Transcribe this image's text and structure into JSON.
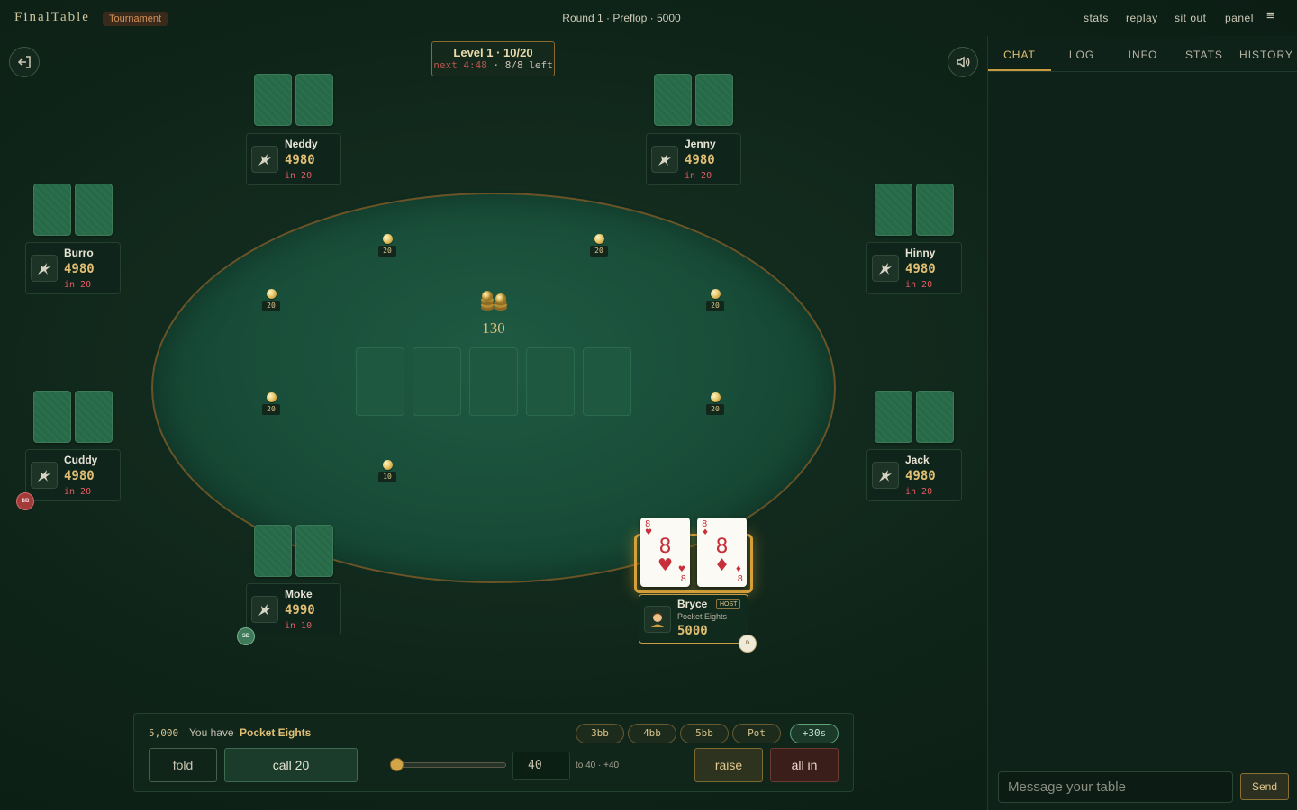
{
  "app": {
    "name": "FinalTable",
    "mode": "Tournament",
    "round_info": "Round 1 · Preflop · 5000"
  },
  "top_links": [
    "stats",
    "replay",
    "sit out",
    "panel"
  ],
  "menu_icon": "hamburger-icon",
  "level": {
    "title": "Level 1 · 10/20",
    "next_label": "next 4:48",
    "players_left": "· 8/8 left"
  },
  "seats": [
    {
      "name": "Neddy",
      "stack": "4980",
      "bet_label": "in 20",
      "chip": "20"
    },
    {
      "name": "Jenny",
      "stack": "4980",
      "bet_label": "in 20",
      "chip": "20"
    },
    {
      "name": "Burro",
      "stack": "4980",
      "bet_label": "in 20",
      "chip": "20"
    },
    {
      "name": "Hinny",
      "stack": "4980",
      "bet_label": "in 20",
      "chip": "20"
    },
    {
      "name": "Cuddy",
      "stack": "4980",
      "bet_label": "in 20",
      "chip": "20",
      "badge": "BB"
    },
    {
      "name": "Jack",
      "stack": "4980",
      "bet_label": "in 20",
      "chip": "20"
    },
    {
      "name": "Moke",
      "stack": "4990",
      "bet_label": "in 10",
      "chip": "10",
      "badge": "SB"
    }
  ],
  "pot": {
    "amount": "130"
  },
  "hero": {
    "name": "Bryce",
    "badge": "HOST",
    "hand_name": "Pocket Eights",
    "stack": "5000",
    "dealer_badge": "D",
    "avatar_icon": "person-emoji-icon",
    "cards": [
      {
        "rank": "8",
        "suit": "♥"
      },
      {
        "rank": "8",
        "suit": "♦"
      }
    ]
  },
  "action_bar": {
    "stack": "5,000",
    "you_have": "You have",
    "hand": "Pocket Eights",
    "presets": [
      "3bb",
      "4bb",
      "5bb",
      "Pot",
      "+30s"
    ],
    "fold_label": "fold",
    "call_label": "call 20",
    "raise_value": "40",
    "raise_range": "to 40 · +40",
    "raise_label": "raise",
    "allin_label": "all in"
  },
  "panel": {
    "tabs": [
      "CHAT",
      "LOG",
      "INFO",
      "STATS",
      "HISTORY"
    ],
    "active_tab": "CHAT",
    "chat_placeholder": "Message your table",
    "send_label": "Send"
  },
  "colors": {
    "felt": "#1f5a43",
    "gold_accent": "#e0be73",
    "bet_red": "#e25c63",
    "background": "#0f2419"
  }
}
